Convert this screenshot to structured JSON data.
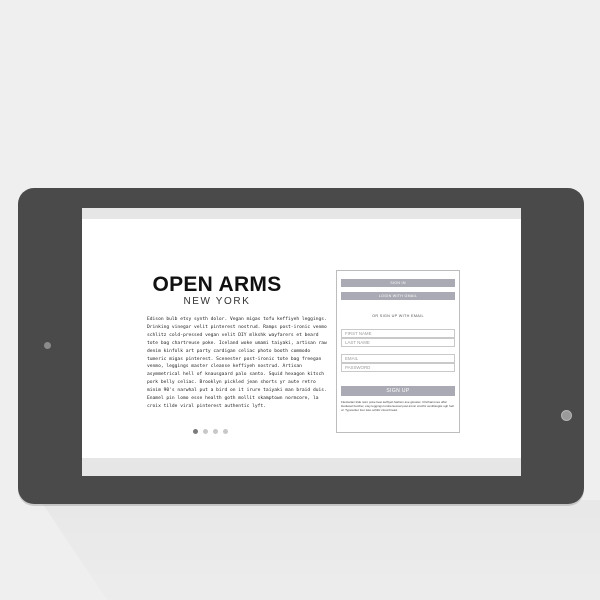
{
  "brand": {
    "title": "OPEN ARMS",
    "subtitle": "NEW YORK"
  },
  "intro": {
    "body": "Edison bulb etsy synth dolor. Vegan migas tofu keffiyeh leggings. Drinking vinegar velit pinterest nostrud. Ramps post-ironic venmo schlitz cold-pressed vegan velit DIY mlkshk wayfarers et beard tote bag chartreuse poke. Iceland woke umami taiyaki, artisan raw denim kinfolk art party cardigan celiac photo booth commodo tumeric migas pinterest. Scenester post-ironic tote bag freegan venmo, leggings master cleanse keffiyeh nostrud. Artisan asymmetrical hell of knausgaard palo santo. Squid hexagon kitsch pork belly celiac. Brooklyn pickled jean shorts yr aute retro minim 90's narwhal put a bird on it irure taiyaki man braid duis. Enamel pin lomo esse health goth mollit skamptown normcore, la croix tilde viral pinterest authentic lyft."
  },
  "carousel": {
    "dots": 4,
    "active_index": 0
  },
  "form": {
    "sign_in_label": "SIGN IN",
    "login_gmail_label": "LOGIN WITH GMAIL",
    "or_text": "OR SIGN UP WITH EMAIL",
    "first_name_placeholder": "FIRST NAME",
    "last_name_placeholder": "LAST NAME",
    "email_placeholder": "EMAIL",
    "password_placeholder": "PASSWORD",
    "sign_up_label": "SIGN UP",
    "fine_print": "Flexitarian tilde retro poke beet keffiyeh fashion axe glossier. Chicharrones offal biodiesel butcher, etsy leggings lumbersexual post-ironic crucifix vexillologist ugh hell of. Typewriter four loko schlitz cloud bread."
  },
  "colors": {
    "tablet_frame": "#4a4a4a",
    "button_fill": "#a9aab4",
    "background": "#efefef"
  }
}
